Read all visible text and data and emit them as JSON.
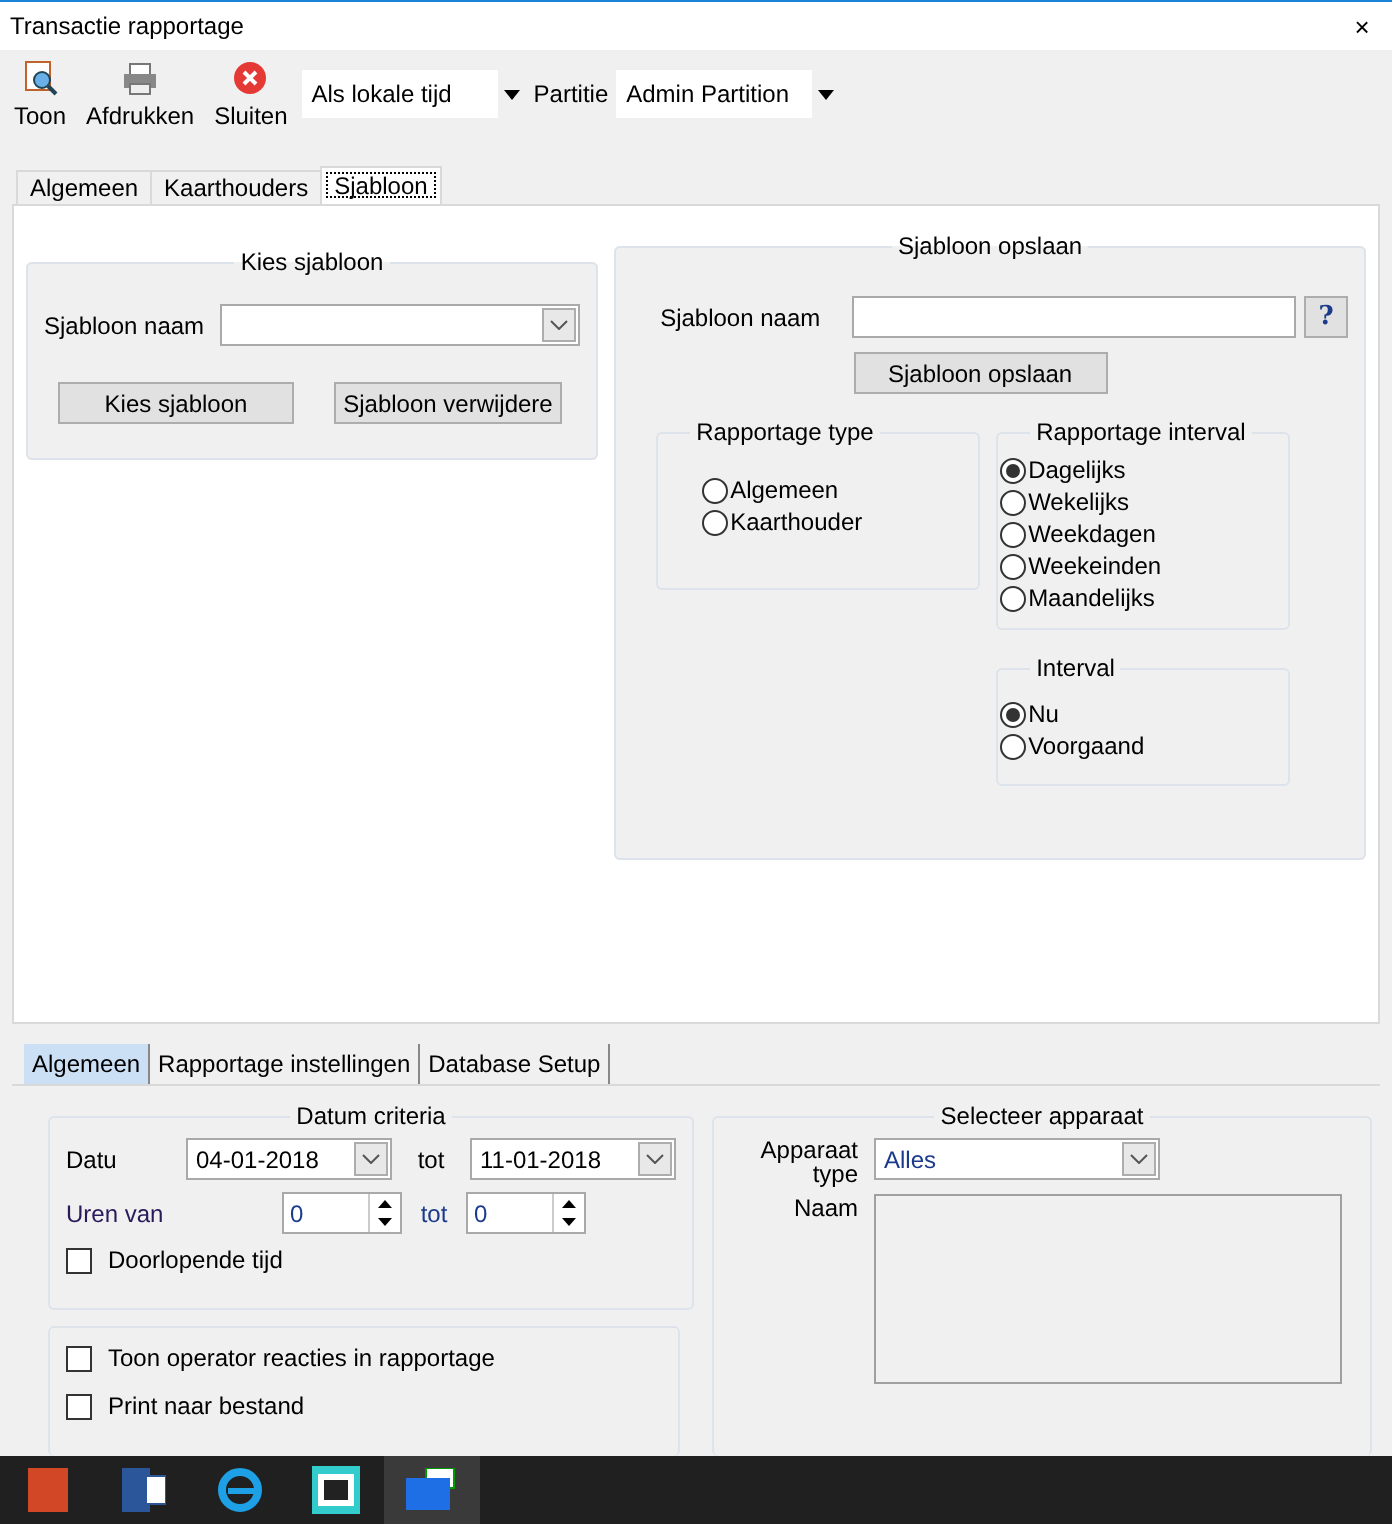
{
  "window": {
    "title": "Transactie rapportage",
    "close": "×"
  },
  "toolbar": {
    "buttons": [
      {
        "kind": "view",
        "label": "Toon"
      },
      {
        "kind": "print",
        "label": "Afdrukken"
      },
      {
        "kind": "close",
        "label": "Sluiten"
      }
    ],
    "time_mode": "Als lokale tijd",
    "partition_label": "Partitie",
    "partition": "Admin Partition"
  },
  "top_tabs": [
    {
      "label": "Algemeen",
      "selected": false
    },
    {
      "label": "Kaarthouders",
      "selected": false
    },
    {
      "label": "Sjabloon",
      "selected": true
    }
  ],
  "choose_template": {
    "title": "Kies sjabloon",
    "name_label": "Sjabloon naam",
    "buttons": [
      "Kies sjabloon",
      "Sjabloon verwijdere"
    ]
  },
  "save_template": {
    "title": "Sjabloon opslaan",
    "name_label": "Sjabloon naam",
    "help": "?",
    "save_button": "Sjabloon opslaan",
    "groups": [
      {
        "title": "Rapportage type",
        "options": [
          {
            "label": "Algemeen",
            "selected": false
          },
          {
            "label": "Kaarthouder",
            "selected": false
          }
        ]
      },
      {
        "title": "Rapportage interval",
        "options": [
          {
            "label": "Dagelijks",
            "selected": true
          },
          {
            "label": "Wekelijks",
            "selected": false
          },
          {
            "label": "Weekdagen",
            "selected": false
          },
          {
            "label": "Weekeinden",
            "selected": false
          },
          {
            "label": "Maandelijks",
            "selected": false
          }
        ]
      },
      {
        "title": "Interval",
        "options": [
          {
            "label": "Nu",
            "selected": true
          },
          {
            "label": "Voorgaand",
            "selected": false
          }
        ]
      }
    ]
  },
  "bottom_tabs": [
    {
      "label": "Algemeen",
      "selected": true
    },
    {
      "label": "Rapportage instellingen",
      "selected": false
    },
    {
      "label": "Database Setup",
      "selected": false
    }
  ],
  "date_criteria": {
    "title": "Datum criteria",
    "date_label": "Datu",
    "from": "04-01-2018",
    "to_label": "tot",
    "to": "11-01-2018",
    "hours_label": "Uren van",
    "hours_from": "0",
    "hours_to_label": "tot",
    "hours_to": "0",
    "continuous": {
      "label": "Doorlopende tijd",
      "checked": false
    }
  },
  "options": [
    {
      "label": "Toon operator reacties in rapportage",
      "checked": false
    },
    {
      "label": "Print naar bestand",
      "checked": false
    }
  ],
  "device": {
    "title": "Selecteer apparaat",
    "type_label": "Apparaat type",
    "type_value": "Alles",
    "name_label": "Naam"
  }
}
